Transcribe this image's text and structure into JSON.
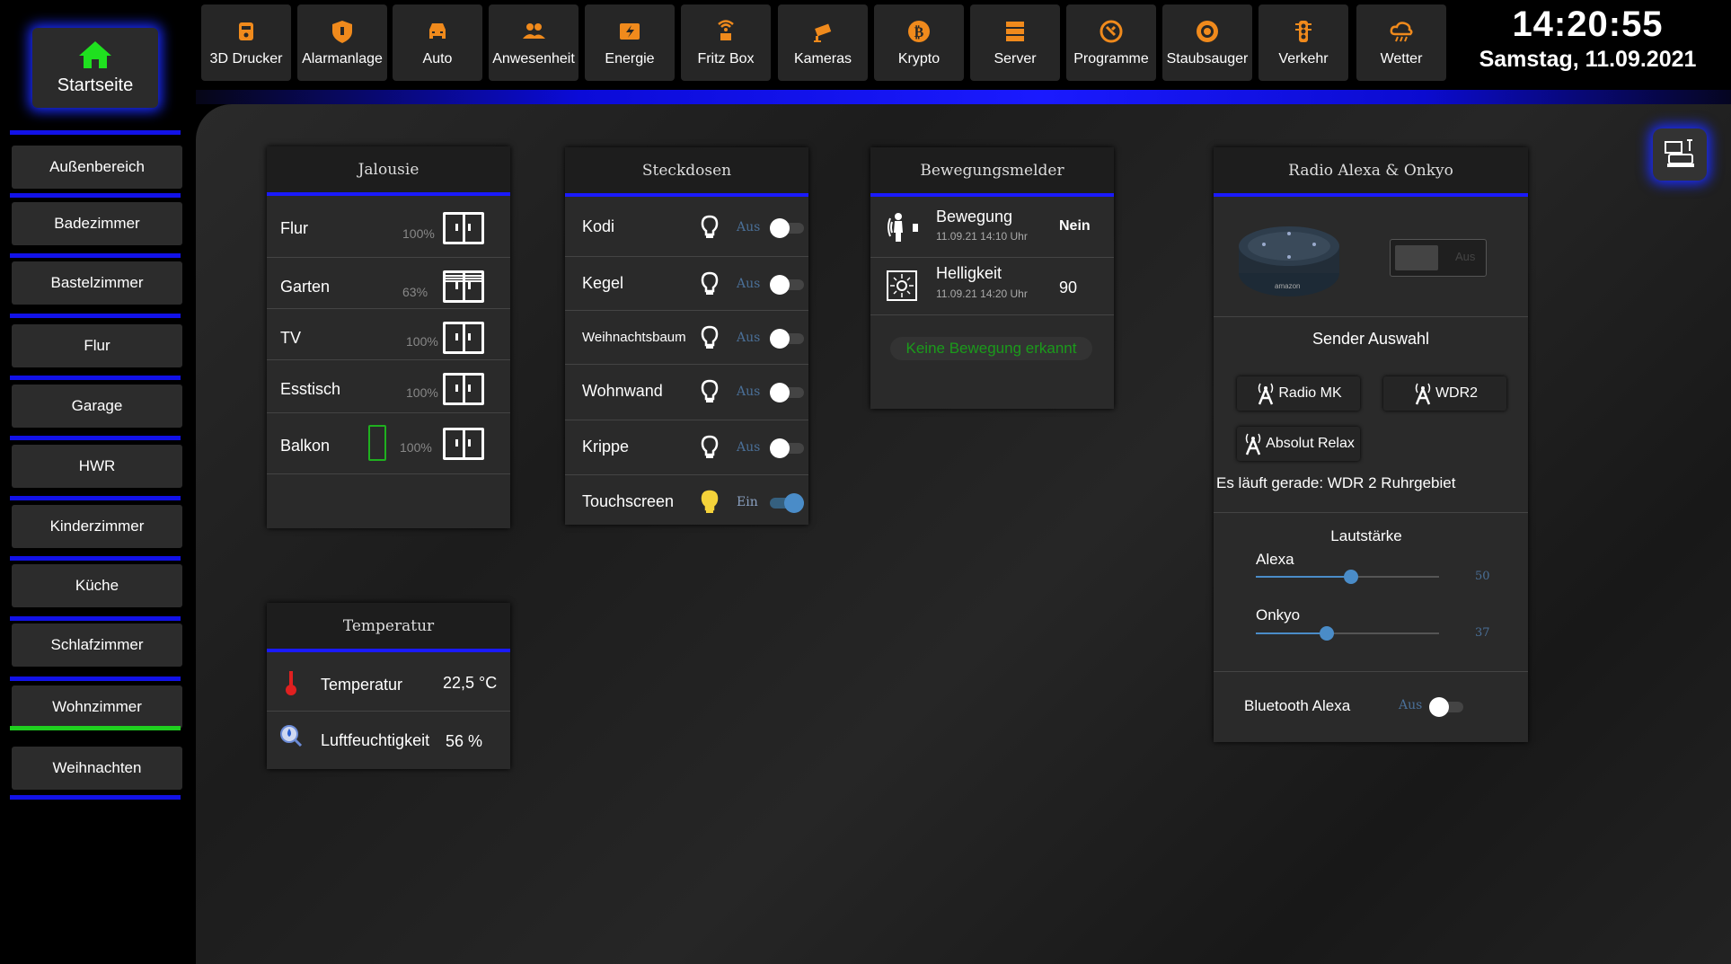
{
  "home": {
    "label": "Startseite"
  },
  "rooms": [
    {
      "label": "Außenbereich"
    },
    {
      "label": "Badezimmer"
    },
    {
      "label": "Bastelzimmer"
    },
    {
      "label": "Flur"
    },
    {
      "label": "Garage"
    },
    {
      "label": "HWR"
    },
    {
      "label": "Kinderzimmer"
    },
    {
      "label": "Küche"
    },
    {
      "label": "Schlafzimmer"
    },
    {
      "label": "Wohnzimmer"
    },
    {
      "label": "Weihnachten"
    }
  ],
  "active_room": "Wohnzimmer",
  "nav": [
    {
      "label": "3D Drucker",
      "icon": "printer-3d-icon"
    },
    {
      "label": "Alarmanlage",
      "icon": "shield-icon"
    },
    {
      "label": "Auto",
      "icon": "car-icon"
    },
    {
      "label": "Anwesenheit",
      "icon": "people-icon"
    },
    {
      "label": "Energie",
      "icon": "energy-icon"
    },
    {
      "label": "Fritz Box",
      "icon": "router-icon"
    },
    {
      "label": "Kameras",
      "icon": "camera-icon"
    },
    {
      "label": "Krypto",
      "icon": "bitcoin-icon"
    },
    {
      "label": "Server",
      "icon": "server-icon"
    },
    {
      "label": "Programme",
      "icon": "programs-icon"
    },
    {
      "label": "Staubsauger",
      "icon": "vacuum-icon"
    },
    {
      "label": "Verkehr",
      "icon": "traffic-light-icon"
    },
    {
      "label": "Wetter",
      "icon": "weather-icon"
    }
  ],
  "accent_color": "#f08a1c",
  "clock": {
    "time": "14:20:55",
    "date": "Samstag, 11.09.2021"
  },
  "jalousie": {
    "title": "Jalousie",
    "items": [
      {
        "name": "Flur",
        "value": "100%",
        "level": 1.0
      },
      {
        "name": "Garten",
        "value": "63%",
        "level": 0.63
      },
      {
        "name": "TV",
        "value": "100%",
        "level": 1.0
      },
      {
        "name": "Esstisch",
        "value": "100%",
        "level": 1.0
      },
      {
        "name": "Balkon",
        "value": "100%",
        "level": 1.0
      }
    ]
  },
  "steckdosen": {
    "title": "Steckdosen",
    "items": [
      {
        "name": "Kodi",
        "state": "Aus",
        "on": false
      },
      {
        "name": "Kegel",
        "state": "Aus",
        "on": false
      },
      {
        "name": "Weihnachtsbaum",
        "state": "Aus",
        "on": false
      },
      {
        "name": "Wohnwand",
        "state": "Aus",
        "on": false
      },
      {
        "name": "Krippe",
        "state": "Aus",
        "on": false
      },
      {
        "name": "Touchscreen",
        "state": "Ein",
        "on": true
      }
    ]
  },
  "bewegung": {
    "title": "Bewegungsmelder",
    "items": [
      {
        "name": "Bewegung",
        "time": "11.09.21 14:10 Uhr",
        "value": "Nein"
      },
      {
        "name": "Helligkeit",
        "time": "11.09.21 14:20 Uhr",
        "value": "90"
      }
    ],
    "status": "Keine Bewegung erkannt"
  },
  "temperatur": {
    "title": "Temperatur",
    "items": [
      {
        "name": "Temperatur",
        "value": "22,5 °C"
      },
      {
        "name": "Luftfeuchtigkeit",
        "value": "56 %"
      }
    ]
  },
  "radio": {
    "title": "Radio Alexa & Onkyo",
    "device_label": "amazon",
    "power_state": "Aus",
    "sender_title": "Sender Auswahl",
    "stations": [
      "Radio MK",
      "WDR2",
      "Absolut Relax"
    ],
    "now_playing": "Es läuft gerade: WDR 2 Ruhrgebiet",
    "volume_title": "Lautstärke",
    "volumes": [
      {
        "name": "Alexa",
        "value": 50
      },
      {
        "name": "Onkyo",
        "value": 37
      }
    ],
    "bluetooth": {
      "name": "Bluetooth Alexa",
      "state": "Aus",
      "on": false
    }
  }
}
